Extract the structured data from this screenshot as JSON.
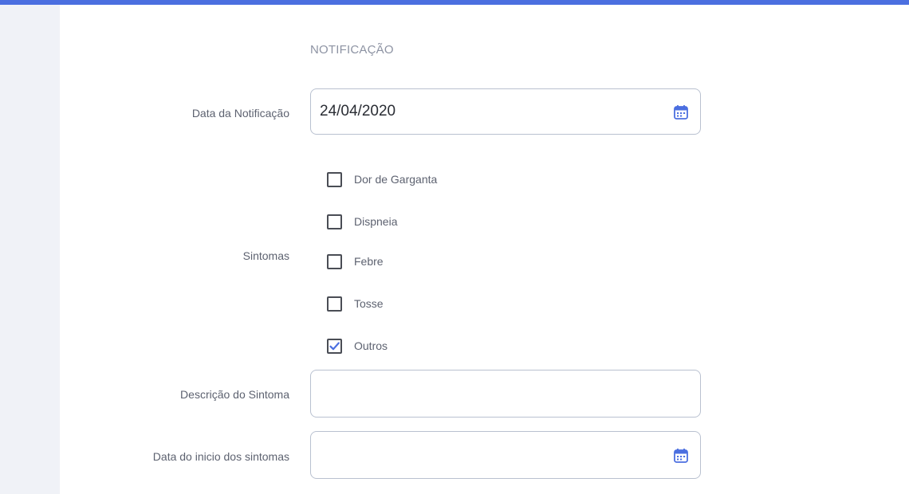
{
  "theme": {
    "accent": "#4b6fe0",
    "sidebar_bg": "#f0f2f7",
    "border": "#b9c1d0"
  },
  "section": {
    "title": "NOTIFICAÇÃO"
  },
  "fields": {
    "notification_date": {
      "label": "Data da Notificação",
      "value": "24/04/2020",
      "icon": "calendar-icon"
    },
    "symptoms": {
      "label": "Sintomas",
      "options": [
        {
          "label": "Dor de Garganta",
          "checked": false
        },
        {
          "label": "Dispneia",
          "checked": false
        },
        {
          "label": "Febre",
          "checked": false
        },
        {
          "label": "Tosse",
          "checked": false
        },
        {
          "label": "Outros",
          "checked": true
        }
      ]
    },
    "symptom_description": {
      "label": "Descrição do Sintoma",
      "value": ""
    },
    "symptom_start_date": {
      "label": "Data do inicio dos sintomas",
      "value": "",
      "icon": "calendar-icon"
    }
  }
}
